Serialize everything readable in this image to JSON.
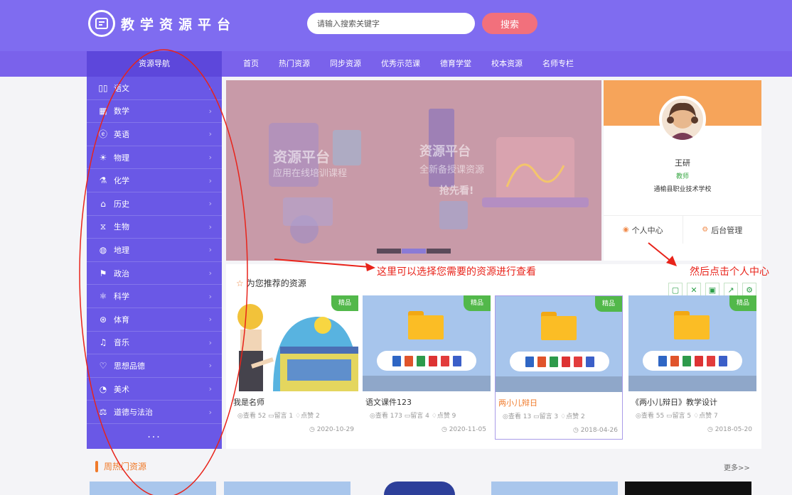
{
  "brand": {
    "logo_text": "教学资源平台"
  },
  "search": {
    "placeholder": "请输入搜索关键字",
    "button": "搜索"
  },
  "nav": {
    "title": "资源导航",
    "links": [
      "首页",
      "热门资源",
      "同步资源",
      "优秀示范课",
      "德育学堂",
      "校本资源",
      "名师专栏"
    ]
  },
  "sidebar": {
    "items": [
      {
        "label": "语文",
        "icon": "book-icon"
      },
      {
        "label": "数学",
        "icon": "calculator-icon"
      },
      {
        "label": "英语",
        "icon": "english-icon"
      },
      {
        "label": "物理",
        "icon": "lightbulb-icon"
      },
      {
        "label": "化学",
        "icon": "flask-icon"
      },
      {
        "label": "历史",
        "icon": "temple-icon"
      },
      {
        "label": "生物",
        "icon": "dna-icon"
      },
      {
        "label": "地理",
        "icon": "globe-icon"
      },
      {
        "label": "政治",
        "icon": "flag-icon"
      },
      {
        "label": "科学",
        "icon": "atom-icon"
      },
      {
        "label": "体育",
        "icon": "ball-icon"
      },
      {
        "label": "音乐",
        "icon": "music-icon"
      },
      {
        "label": "思想品德",
        "icon": "heart-hands-icon"
      },
      {
        "label": "美术",
        "icon": "palette-icon"
      },
      {
        "label": "道德与法治",
        "icon": "scale-icon"
      }
    ],
    "more": "..."
  },
  "banner": {
    "left_title": "资源平台",
    "left_sub": "应用在线培训课程",
    "right_title": "资源平台",
    "right_sub": "全新备授课资源",
    "right_cta": "抢先看!",
    "slide_count": 3,
    "active_slide": 2
  },
  "profile": {
    "name": "王研",
    "role": "教师",
    "school": "通榆县职业技术学校",
    "actions": [
      "个人中心",
      "后台管理"
    ]
  },
  "recommend": {
    "title": "为您推荐的资源",
    "cards": [
      {
        "title": "我是名师",
        "views": "查看 52",
        "comments": "留言 1",
        "likes": "点赞 2",
        "date": "2020-10-29",
        "badge": "精品",
        "thumb": "cartoon"
      },
      {
        "title": "语文课件123",
        "views": "查看 173",
        "comments": "留言 4",
        "likes": "点赞 9",
        "date": "2020-11-05",
        "badge": "精品",
        "thumb": "folder"
      },
      {
        "title": "两小儿辩日",
        "views": "查看 13",
        "comments": "留言 3",
        "likes": "点赞 2",
        "date": "2018-04-26",
        "badge": "精品",
        "thumb": "folder",
        "selected": true
      },
      {
        "title": "《两小儿辩日》教学设计",
        "views": "查看 55",
        "comments": "留言 5",
        "likes": "点赞 7",
        "date": "2018-05-20",
        "badge": "精品",
        "thumb": "folder"
      }
    ]
  },
  "annotations": {
    "middle": "这里可以选择您需要的资源进行查看",
    "right": "然后点击个人中心"
  },
  "hot": {
    "title": "周热门资源",
    "more": "更多>>"
  },
  "colors": {
    "header": "#7f6cf0",
    "sidebar": "#6a58e6",
    "accent": "#f07a2a",
    "annotation": "#e8231a"
  }
}
